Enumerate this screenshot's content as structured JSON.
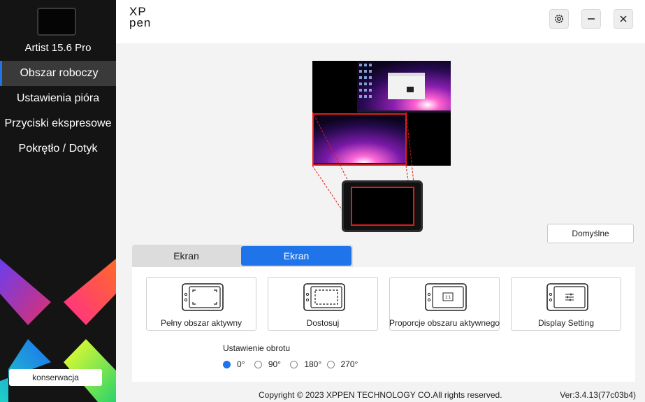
{
  "sidebar": {
    "device_name": "Artist 15.6 Pro",
    "nav": [
      {
        "label": "Obszar roboczy",
        "active": true
      },
      {
        "label": "Ustawienia pióra",
        "active": false
      },
      {
        "label": "Przyciski ekspresowe",
        "active": false
      },
      {
        "label": "Pokrętło / Dotyk",
        "active": false
      }
    ],
    "maintenance_label": "konserwacja"
  },
  "header": {
    "logo_line1": "XP",
    "logo_line2": "pen",
    "icons": [
      "gear-icon",
      "minimize-icon",
      "close-icon"
    ]
  },
  "main": {
    "default_button": "Domyślne",
    "tabs": [
      {
        "label": "Ekran",
        "active": false
      },
      {
        "label": "Ekran",
        "active": true
      }
    ],
    "modes": [
      {
        "label": "Pełny obszar aktywny",
        "icon": "full-area-icon"
      },
      {
        "label": "Dostosuj",
        "icon": "customize-icon"
      },
      {
        "label": "Proporcje obszaru aktywnego",
        "icon": "ratio-icon"
      },
      {
        "label": "Display Setting",
        "icon": "display-setting-icon"
      }
    ],
    "ratio_icon_text": "1:1",
    "rotation_title": "Ustawienie obrotu",
    "rotation_options": [
      "0°",
      "90°",
      "180°",
      "270°"
    ],
    "rotation_selected": "0°"
  },
  "footer": {
    "copyright": "Copyright © 2023  XPPEN TECHNOLOGY CO.All rights reserved.",
    "version": "Ver:3.4.13(77c03b4)"
  },
  "colors": {
    "accent": "#1e74e8",
    "sidebar_bg": "#141414",
    "highlight_red": "#e01b1b"
  }
}
